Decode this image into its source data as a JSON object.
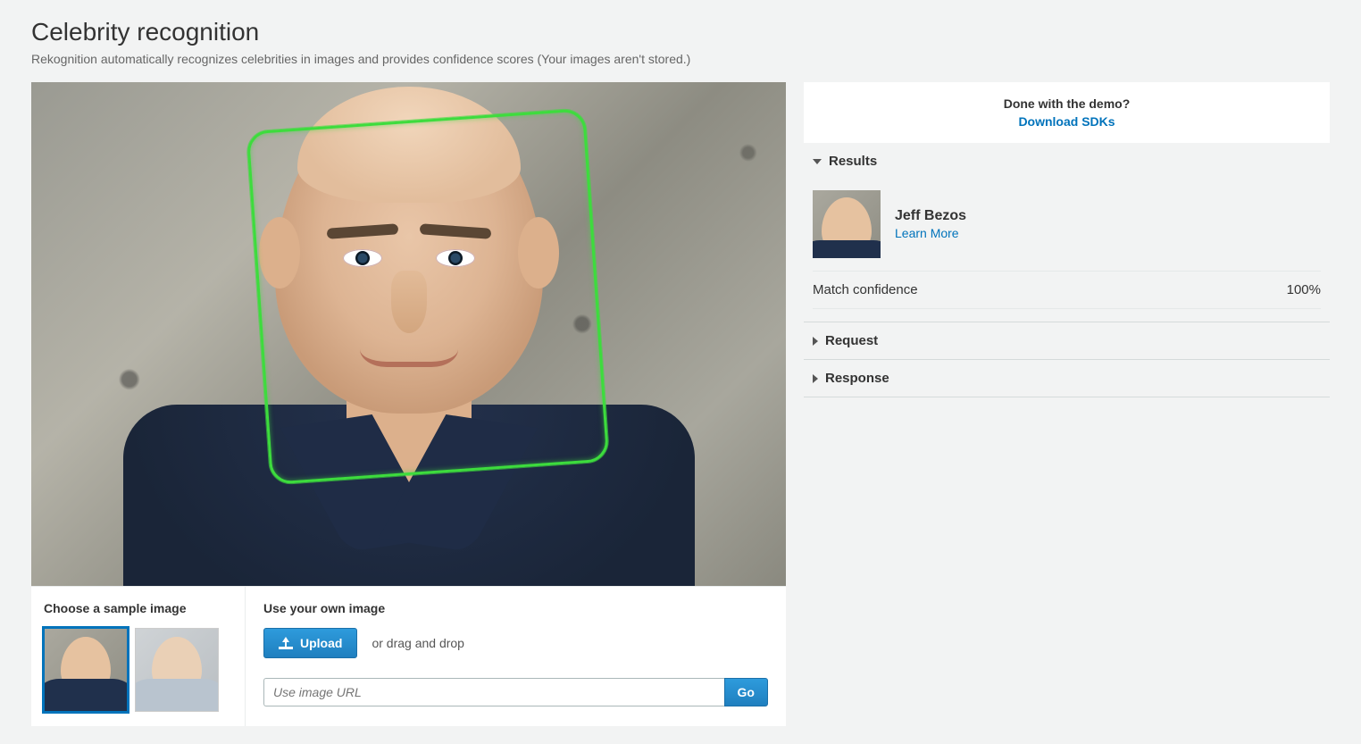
{
  "header": {
    "title": "Celebrity recognition",
    "subtitle": "Rekognition automatically recognizes celebrities in images and provides confidence scores (Your images aren't stored.)"
  },
  "sample": {
    "heading": "Choose a sample image"
  },
  "own": {
    "heading": "Use your own image",
    "upload_label": "Upload",
    "drag_text": "or drag and drop",
    "url_placeholder": "Use image URL",
    "go_label": "Go"
  },
  "sidebar": {
    "done_question": "Done with the demo?",
    "download_link": "Download SDKs",
    "sections": {
      "results": "Results",
      "request": "Request",
      "response": "Response"
    },
    "result": {
      "name": "Jeff Bezos",
      "learn_more": "Learn More",
      "confidence_label": "Match confidence",
      "confidence_value": "100%"
    }
  }
}
